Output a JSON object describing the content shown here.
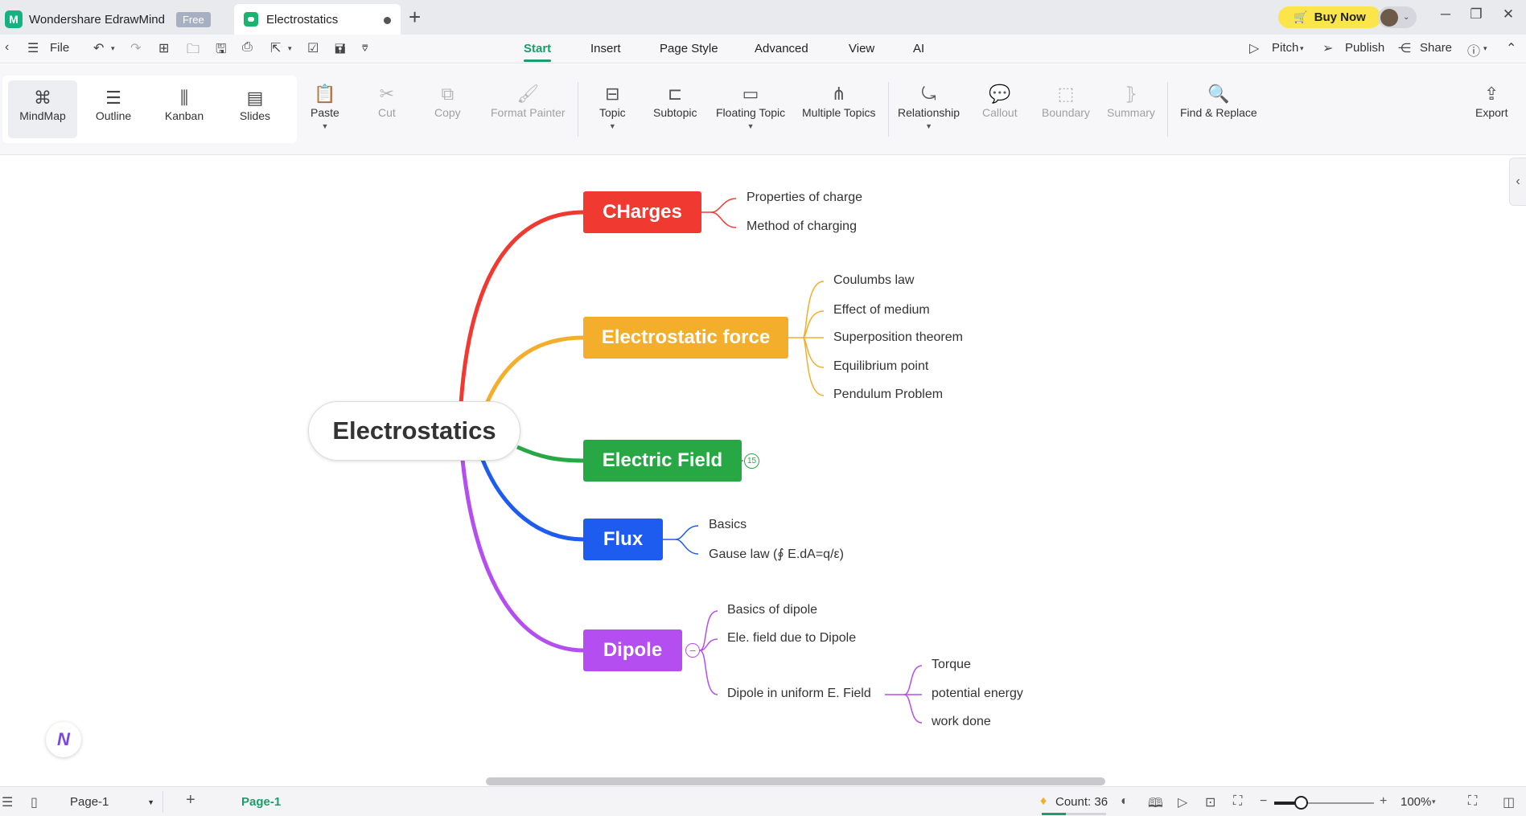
{
  "titlebar": {
    "app_name": "Wondershare EdrawMind",
    "app_logo": "M",
    "free_badge": "Free",
    "doc_tab": "Electrostatics",
    "new_tab": "+",
    "buy_now": "Buy Now",
    "icons": [
      "cart-icon",
      "avatar",
      "minimize-icon",
      "restore-icon",
      "close-icon"
    ]
  },
  "menubar": {
    "file": "File",
    "tabs": [
      "Start",
      "Insert",
      "Page Style",
      "Advanced",
      "View",
      "AI"
    ],
    "active_tab": "Start",
    "pitch": "Pitch",
    "publish": "Publish",
    "share": "Share"
  },
  "ribbon": {
    "views": [
      "MindMap",
      "Outline",
      "Kanban",
      "Slides"
    ],
    "active_view": "MindMap",
    "buttons": {
      "paste": "Paste",
      "cut": "Cut",
      "copy": "Copy",
      "format_painter": "Format Painter",
      "topic": "Topic",
      "subtopic": "Subtopic",
      "floating_topic": "Floating Topic",
      "multiple_topics": "Multiple Topics",
      "relationship": "Relationship",
      "callout": "Callout",
      "boundary": "Boundary",
      "summary": "Summary",
      "find_replace": "Find & Replace",
      "export": "Export"
    }
  },
  "mindmap": {
    "central": "Electrostatics",
    "colors": {
      "charges": "#f03a31",
      "force": "#f3ae2c",
      "field": "#27a844",
      "flux": "#1e5cf0",
      "dipole": "#b44ef0"
    },
    "topics": {
      "charges": {
        "label": "CHarges",
        "children": [
          "Properties of charge",
          "Method of charging"
        ]
      },
      "force": {
        "label": "Electrostatic force",
        "children": [
          "Coulumbs law",
          "Effect of medium",
          "Superposition theorem",
          "Equilibrium point",
          "Pendulum Problem"
        ]
      },
      "field": {
        "label": "Electric Field",
        "collapsed_count": "15"
      },
      "flux": {
        "label": "Flux",
        "children": [
          "Basics",
          "Gause law (∮ E.dA=q/ε)"
        ]
      },
      "dipole": {
        "label": "Dipole",
        "collapse_symbol": "−",
        "children": [
          "Basics of dipole",
          "Ele. field due to Dipole",
          "Dipole in uniform E. Field"
        ],
        "grandchildren": [
          "Torque",
          "potential energy",
          "work done"
        ]
      }
    }
  },
  "statusbar": {
    "page_select": "Page-1",
    "add_page": "+",
    "page_tab": "Page-1",
    "count": "Count: 36",
    "zoom": "100%"
  }
}
